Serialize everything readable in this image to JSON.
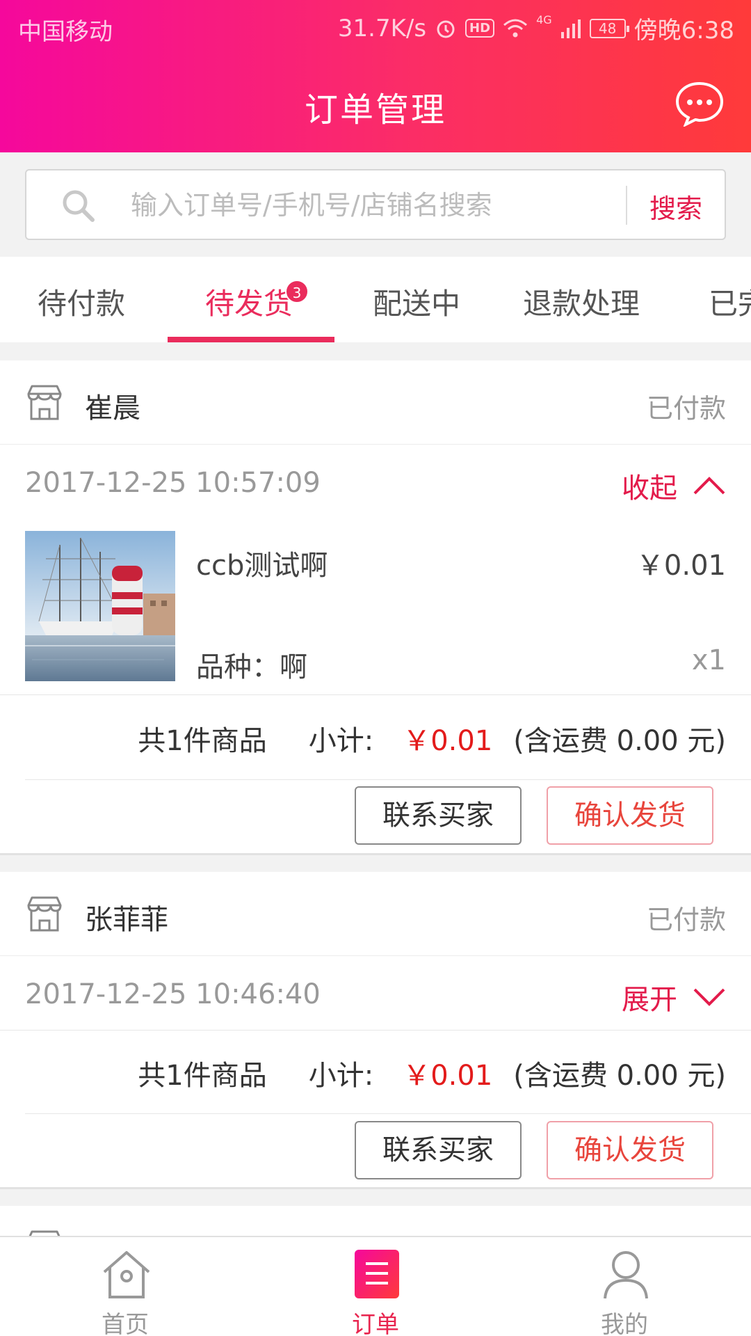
{
  "status_bar": {
    "carrier": "中国移动",
    "speed": "31.7K/s",
    "hd": "HD",
    "network": "4G",
    "battery": "48",
    "time": "傍晚6:38"
  },
  "header": {
    "title": "订单管理",
    "message_icon": "chat-bubble-icon"
  },
  "search": {
    "placeholder": "输入订单号/手机号/店铺名搜索",
    "button_label": "搜索"
  },
  "tabs": [
    {
      "label": "待付款"
    },
    {
      "label": "待发货",
      "badge": "3",
      "active": true
    },
    {
      "label": "配送中"
    },
    {
      "label": "退款处理"
    },
    {
      "label": "已完成"
    }
  ],
  "orders": [
    {
      "shop_name": "崔晨",
      "status": "已付款",
      "time": "2017-12-25 10:57:09",
      "toggle_label": "收起",
      "expanded": true,
      "product": {
        "name": "ccb测试啊",
        "price": "￥0.01",
        "variant": "品种：啊",
        "qty": "x1"
      },
      "count_text": "共1件商品",
      "subtotal_label": "小计:",
      "subtotal": "￥0.01",
      "shipping_note": "(含运费 0.00 元)",
      "contact_label": "联系买家",
      "ship_label": "确认发货"
    },
    {
      "shop_name": "张菲菲",
      "status": "已付款",
      "time": "2017-12-25 10:46:40",
      "toggle_label": "展开",
      "expanded": false,
      "count_text": "共1件商品",
      "subtotal_label": "小计:",
      "subtotal": "￥0.01",
      "shipping_note": "(含运费 0.00 元)",
      "contact_label": "联系买家",
      "ship_label": "确认发货"
    }
  ],
  "bottom_nav": [
    {
      "label": "首页",
      "icon": "home-icon"
    },
    {
      "label": "订单",
      "icon": "order-list-icon",
      "active": true
    },
    {
      "label": "我的",
      "icon": "user-icon"
    }
  ],
  "colors": {
    "accent": "#ea2c5c",
    "price_red": "#e31b1b",
    "header_gradient_start": "#f5089c",
    "header_gradient_end": "#ff3a3a"
  }
}
